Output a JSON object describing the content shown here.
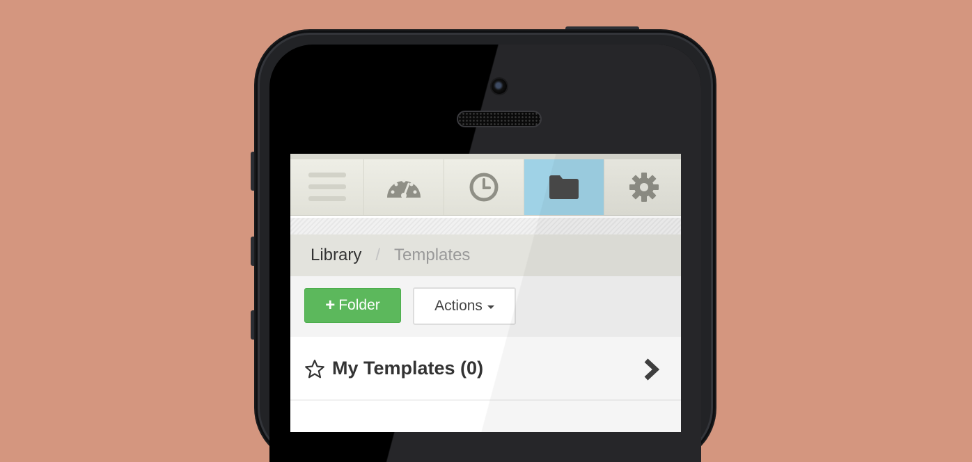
{
  "nav": {
    "items": [
      {
        "icon": "menu-icon",
        "active": false
      },
      {
        "icon": "dashboard-gauge-icon",
        "active": false
      },
      {
        "icon": "clock-icon",
        "active": false
      },
      {
        "icon": "folder-icon",
        "active": true
      },
      {
        "icon": "gear-icon",
        "active": false
      }
    ]
  },
  "breadcrumb": {
    "link": "Library",
    "separator": "/",
    "current": "Templates"
  },
  "toolbar": {
    "folder_button": {
      "icon": "plus-icon",
      "label": "Folder"
    },
    "actions_button": {
      "label": "Actions",
      "icon": "caret-down-icon"
    }
  },
  "list": {
    "items": [
      {
        "icon": "star-outline-icon",
        "label": "My Templates (0)",
        "chevron": "chevron-right-icon"
      }
    ]
  },
  "colors": {
    "background": "#d4967f",
    "active_nav": "#9fd2e6",
    "success_button": "#5cb85c"
  }
}
